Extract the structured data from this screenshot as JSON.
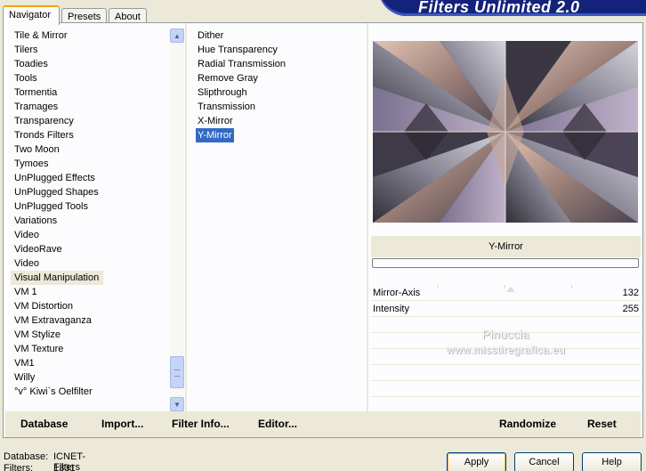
{
  "app": {
    "title": "Filters Unlimited 2.0"
  },
  "tabs": [
    {
      "label": "Navigator",
      "active": true
    },
    {
      "label": "Presets",
      "active": false
    },
    {
      "label": "About",
      "active": false
    }
  ],
  "categories": {
    "items": [
      "Tile & Mirror",
      "Tilers",
      "Toadies",
      "Tools",
      "Tormentia",
      "Tramages",
      "Transparency",
      "Tronds Filters",
      "Two Moon",
      "Tymoes",
      "UnPlugged Effects",
      "UnPlugged Shapes",
      "UnPlugged Tools",
      "Variations",
      "Video",
      "VideoRave",
      "Video",
      "Visual Manipulation",
      "VM 1",
      "VM Distortion",
      "VM Extravaganza",
      "VM Stylize",
      "VM Texture",
      "VM1",
      "Willy",
      "°v° Kiwi`s Oelfilter"
    ],
    "selected": "Visual Manipulation"
  },
  "filters": {
    "items": [
      "Dither",
      "Hue Transparency",
      "Radial Transmission",
      "Remove Gray",
      "Slipthrough",
      "Transmission",
      "X-Mirror",
      "Y-Mirror"
    ],
    "selected": "Y-Mirror"
  },
  "preview": {
    "filter_name": "Y-Mirror",
    "progress": 0
  },
  "params": [
    {
      "label": "Mirror-Axis",
      "value": "132"
    },
    {
      "label": "Intensity",
      "value": "255"
    }
  ],
  "watermark": {
    "line1": "Pinuccia",
    "line2": "www.misstiregrafica.eu"
  },
  "bottom_bar": {
    "database": "Database",
    "import": "Import...",
    "filter_info": "Filter Info...",
    "editor": "Editor...",
    "randomize": "Randomize",
    "reset": "Reset"
  },
  "status": {
    "database_label": "Database:",
    "database_value": "ICNET-Filters",
    "filters_label": "Filters:",
    "filters_value": "1331"
  },
  "buttons": {
    "apply": "Apply",
    "cancel": "Cancel",
    "help": "Help"
  },
  "colors": {
    "selection": "#316ac5",
    "banner": "#14237a",
    "tab_accent": "#f6a300"
  }
}
